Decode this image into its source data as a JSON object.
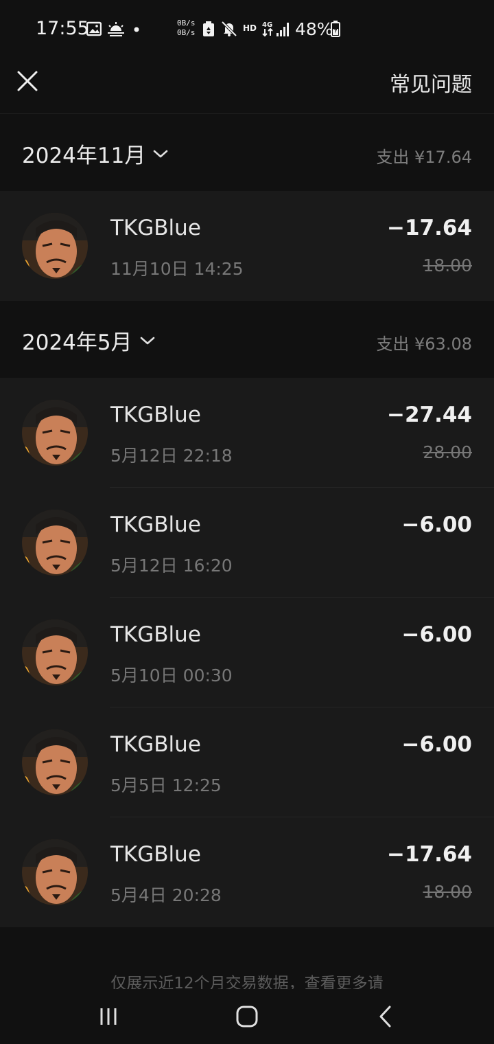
{
  "status_bar": {
    "time": "17:55",
    "speed": "0B/s\n0B/s",
    "hd": "HD",
    "battery": "48%",
    "icons": [
      "image-icon",
      "weather-icon",
      "dot-icon",
      "recycle-icon",
      "mute-icon",
      "network-4g-icon",
      "signal-icon",
      "battery-icon"
    ]
  },
  "header": {
    "close_icon": "close-icon",
    "faq_label": "常见问题"
  },
  "months": [
    {
      "title": "2024年11月",
      "total": "支出 ¥17.64",
      "transactions": [
        {
          "name": "TKGBlue",
          "time": "11月10日 14:25",
          "amount": "−17.64",
          "original": "18.00"
        }
      ]
    },
    {
      "title": "2024年5月",
      "total": "支出 ¥63.08",
      "transactions": [
        {
          "name": "TKGBlue",
          "time": "5月12日 22:18",
          "amount": "−27.44",
          "original": "28.00"
        },
        {
          "name": "TKGBlue",
          "time": "5月12日 16:20",
          "amount": "−6.00",
          "original": ""
        },
        {
          "name": "TKGBlue",
          "time": "5月10日 00:30",
          "amount": "−6.00",
          "original": ""
        },
        {
          "name": "TKGBlue",
          "time": "5月5日 12:25",
          "amount": "−6.00",
          "original": ""
        },
        {
          "name": "TKGBlue",
          "time": "5月4日 20:28",
          "amount": "−17.64",
          "original": "18.00"
        }
      ]
    }
  ],
  "footer": {
    "note": "仅展示近12个月交易数据，查看更多请"
  },
  "nav": {
    "recents_icon": "recents-icon",
    "home_icon": "home-icon",
    "back_icon": "back-icon"
  },
  "colors": {
    "background": "#111111",
    "card": "#1a1a1a",
    "text_primary": "#e6e6e6",
    "text_secondary": "#777777"
  }
}
